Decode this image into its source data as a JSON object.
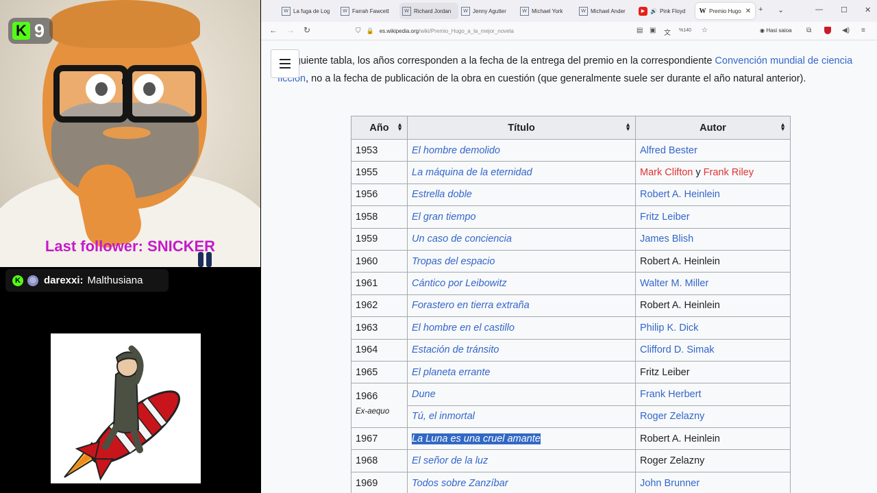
{
  "overlay": {
    "kick_count": "9",
    "last_follower": "Last follower: SNICKER",
    "chat": {
      "user": "darexxi:",
      "message": "Malthusiana"
    }
  },
  "browser": {
    "tabs": [
      {
        "label": "La fuga de Log",
        "icon": "wiki-favicon"
      },
      {
        "label": "Farrah Fawcett",
        "icon": "wiki-favicon"
      },
      {
        "label": "Richard Jordan",
        "icon": "wiki-favicon"
      },
      {
        "label": "Jenny Agutter",
        "icon": "wiki-favicon"
      },
      {
        "label": "Michael York",
        "icon": "wiki-favicon"
      },
      {
        "label": "Michael Ander",
        "icon": "wiki-favicon"
      },
      {
        "label": "Pink Floyd",
        "icon": "youtube-favicon"
      },
      {
        "label": "Premio Hugo",
        "icon": "wikipedia-w"
      }
    ],
    "url_host": "es.wikipedia.org",
    "url_path": "/wiki/Premio_Hugo_a_la_mejor_novela",
    "zoom": "%140",
    "login_label": "Hasi saioa"
  },
  "article": {
    "intro_a": "la siguiente tabla, los años corresponden a la fecha de la entrega del premio en la correspondiente ",
    "intro_link": "Convención mundial de ciencia ficción",
    "intro_b": ", no a la fecha de publicación de la obra en cuestión (que generalmente suele ser durante el año natural anterior)."
  },
  "table": {
    "headers": [
      "Año",
      "Título",
      "Autor"
    ],
    "exaequo_label": "Ex-aequo",
    "rows": [
      {
        "year": "1953",
        "title": "El hombre demolido",
        "author": "Alfred Bester",
        "linked": true
      },
      {
        "year": "1955",
        "title": "La máquina de la eternidad",
        "author_a": "Mark Clifton",
        "author_sep": " y ",
        "author_b": "Frank Riley"
      },
      {
        "year": "1956",
        "title": "Estrella doble",
        "author": "Robert A. Heinlein",
        "linked": true
      },
      {
        "year": "1958",
        "title": "El gran tiempo",
        "author": "Fritz Leiber",
        "linked": true
      },
      {
        "year": "1959",
        "title": "Un caso de conciencia",
        "author": "James Blish",
        "linked": true
      },
      {
        "year": "1960",
        "title": "Tropas del espacio",
        "author": "Robert A. Heinlein",
        "linked": false
      },
      {
        "year": "1961",
        "title": "Cántico por Leibowitz",
        "author": "Walter M. Miller",
        "linked": true
      },
      {
        "year": "1962",
        "title": "Forastero en tierra extraña",
        "author": "Robert A. Heinlein",
        "linked": false
      },
      {
        "year": "1963",
        "title": "El hombre en el castillo",
        "author": "Philip K. Dick",
        "linked": true
      },
      {
        "year": "1964",
        "title": "Estación de tránsito",
        "author": "Clifford D. Simak",
        "linked": true
      },
      {
        "year": "1965",
        "title": "El planeta errante",
        "author": "Fritz Leiber",
        "linked": false
      },
      {
        "year": "1966",
        "title": "Dune",
        "author": "Frank Herbert",
        "linked": true
      },
      {
        "year": "",
        "title": "Tú, el inmortal",
        "author": "Roger Zelazny",
        "linked": true
      },
      {
        "year": "1967",
        "title": "La Luna es una cruel amante",
        "author": "Robert A. Heinlein",
        "linked": false,
        "selected": true
      },
      {
        "year": "1968",
        "title": "El señor de la luz",
        "author": "Roger Zelazny",
        "linked": false
      },
      {
        "year": "1969",
        "title": "Todos sobre Zanzíbar",
        "author": "John Brunner",
        "linked": true
      }
    ]
  },
  "colors": {
    "link": "#3366cc",
    "redlink": "#d33",
    "selection": "#3268c5",
    "kick_green": "#53fc18",
    "follower_magenta": "#c619c9"
  }
}
